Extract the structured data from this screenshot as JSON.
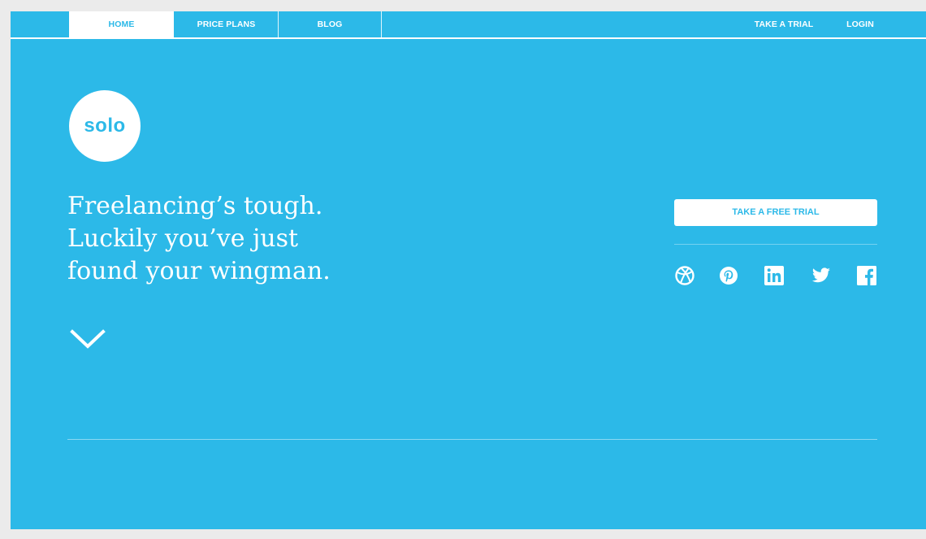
{
  "nav": {
    "left": [
      {
        "label": "HOME",
        "active": true
      },
      {
        "label": "PRICE PLANS",
        "active": false
      },
      {
        "label": "BLOG",
        "active": false
      }
    ],
    "right": [
      {
        "label": "TAKE A TRIAL"
      },
      {
        "label": "LOGIN"
      }
    ]
  },
  "logo": {
    "text": "solo"
  },
  "hero": {
    "lines": [
      "Freelancing’s tough.",
      "Luckily you’ve just",
      "found your wingman."
    ]
  },
  "cta": {
    "label": "TAKE A FREE TRIAL"
  },
  "social": [
    "dribbble-icon",
    "pinterest-icon",
    "linkedin-icon",
    "twitter-icon",
    "facebook-icon"
  ],
  "colors": {
    "background": "#2cb9e8",
    "text": "#ffffff",
    "page": "#ebebeb"
  }
}
